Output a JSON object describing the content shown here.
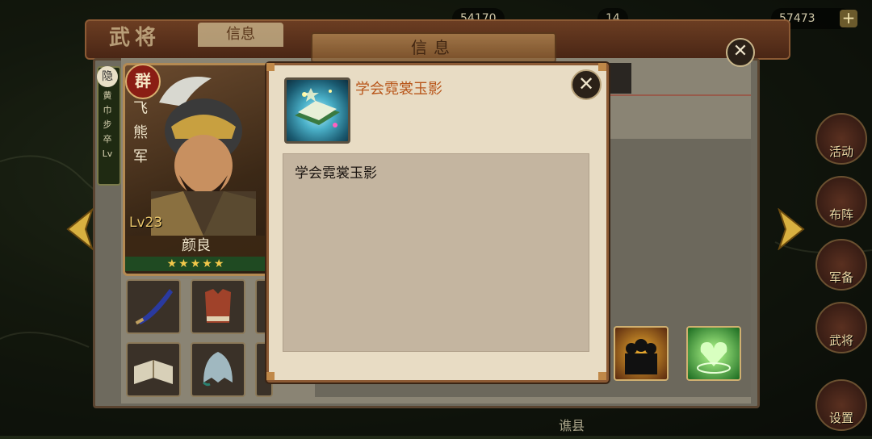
{
  "top_bar": {
    "resource_1": "54170",
    "resource_2": "14",
    "resource_3": "57473",
    "plus_label": "+"
  },
  "back_panel": {
    "title": "武将",
    "tab_label": "信息",
    "center_tab_label": "信息",
    "close_label": "✕"
  },
  "hero": {
    "faction": "群",
    "unit_name": "飞熊军",
    "level": "Lv23",
    "name": "颜良",
    "stars": "★★★★★"
  },
  "side_tag": {
    "top": "隐",
    "text": "黄巾步卒Lv"
  },
  "side_menu": {
    "items": [
      "活动",
      "布阵",
      "军备",
      "武将",
      "设置"
    ]
  },
  "map_label": "谯县",
  "dialog": {
    "item_title": "学会霓裳玉影",
    "description": "学会霓裳玉影",
    "close_label": "✕"
  },
  "colors": {
    "dialog_bg": "#e8dcc4",
    "desc_box_bg": "#c4b5a0",
    "title_orange": "#b8561a",
    "panel_border": "#8c5a34"
  }
}
